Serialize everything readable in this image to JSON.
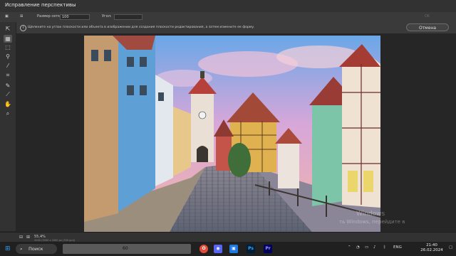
{
  "window": {
    "title": "Исправление перспективы"
  },
  "options": {
    "grid_size_label": "Размер сетки:",
    "grid_size_value": "100",
    "angle_label": "Угол:",
    "ok_label": "OK"
  },
  "info": {
    "message": "Щелкните на углах плоскости или объекта в изображении для создания плоскости редактирования, а затем измените ее форму.",
    "cancel_label": "Отмена"
  },
  "status": {
    "zoom": "55,4%",
    "detail": "3000 (3000 x 2000 px (300 ppi))"
  },
  "watermark": {
    "line1": "Windows",
    "line2": "ть Windows, перейдите в"
  },
  "taskbar": {
    "search_label": "Поиск",
    "search_field_value": "60",
    "language": "ENG",
    "time": "21:40",
    "date": "26.02.2024"
  },
  "colors": {
    "accent": "#3a3a3a",
    "canvas": "#262626",
    "photoshop": "#31a8ff",
    "premiere": "#9999ff"
  }
}
